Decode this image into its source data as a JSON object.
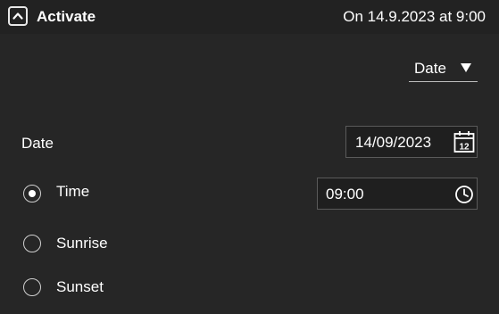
{
  "header": {
    "title": "Activate",
    "summary": "On 14.9.2023 at 9:00",
    "collapse_icon": "chevron-up-icon"
  },
  "mode_select": {
    "value": "Date",
    "icon": "triangle-down-icon"
  },
  "date_field": {
    "label": "Date",
    "value": "14/09/2023",
    "icon": "calendar-icon",
    "calendar_day": "12"
  },
  "time_options": [
    {
      "label": "Time",
      "selected": true
    },
    {
      "label": "Sunrise",
      "selected": false
    },
    {
      "label": "Sunset",
      "selected": false
    }
  ],
  "time_field": {
    "value": "09:00",
    "icon": "clock-icon"
  },
  "colors": {
    "background": "#262626",
    "text": "#ffffff",
    "input_border": "#5a5a5a"
  }
}
